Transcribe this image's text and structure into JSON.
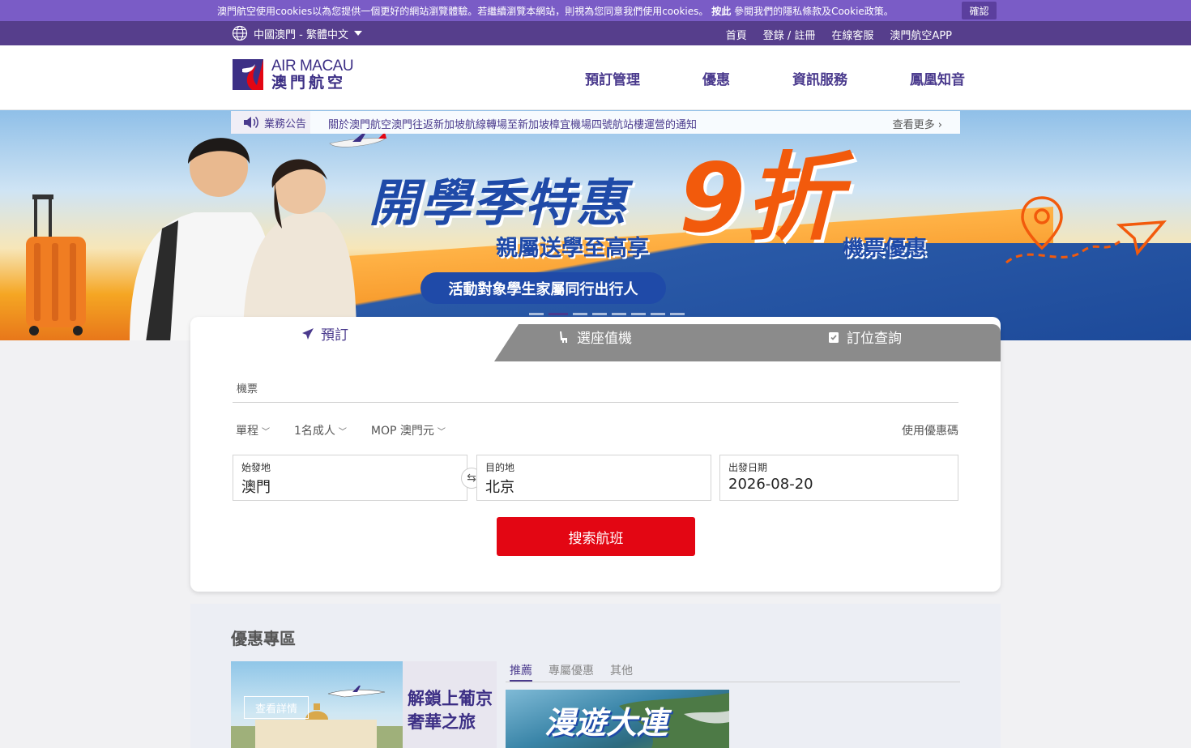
{
  "cookie": {
    "text_pre": "澳門航空使用cookies以為您提供一個更好的網站瀏覽體驗。若繼續瀏覽本網站，則視為您同意我們使用cookies。",
    "link": "按此",
    "text_post": "參閱我們的隱私條款及Cookie政策。",
    "confirm": "確認"
  },
  "topnav": {
    "locale": "中國澳門 - 繁體中文",
    "links": [
      "首頁",
      "登錄 / 註冊",
      "在線客服",
      "澳門航空APP"
    ]
  },
  "header": {
    "logo_en": "AIR MACAU",
    "logo_zh": "澳門航空",
    "nav": [
      "預訂管理",
      "優惠",
      "資訊服務",
      "鳳凰知音"
    ]
  },
  "notice": {
    "tag": "業務公告",
    "message": "關於澳門航空澳門往返新加坡航線轉場至新加坡樟宜機場四號航站樓運營的通知",
    "more": "查看更多"
  },
  "hero": {
    "title": "開學季特惠",
    "big": "9折",
    "sub": "親屬送學至高享",
    "sub2": "機票優惠",
    "pill": "活動對象學生家屬同行出行人",
    "active_slide": 2,
    "slide_count": 8
  },
  "booking": {
    "tabs": [
      "預訂",
      "選座值機",
      "訂位查詢"
    ],
    "active_tab": 0,
    "product": "機票",
    "trip_type": "單程",
    "passengers": "1名成人",
    "currency": "MOP 澳門元",
    "promo_code": "使用優惠碼",
    "origin_label": "始發地",
    "origin": "澳門",
    "dest_label": "目的地",
    "dest": "北京",
    "date_label": "出發日期",
    "date": "2026-08-20",
    "search": "搜索航班"
  },
  "promotions": {
    "title": "優惠專區",
    "card_title_1": "解鎖上葡京",
    "card_title_2": "奢華之旅",
    "card_detail": "查看詳情",
    "tabs": [
      "推薦",
      "專屬優惠",
      "其他"
    ],
    "active_tab": 0,
    "image_text": "漫遊大連"
  },
  "colors": {
    "brand_purple": "#563e8c",
    "cookie_purple": "#7a5cc6",
    "search_red": "#e30613"
  }
}
